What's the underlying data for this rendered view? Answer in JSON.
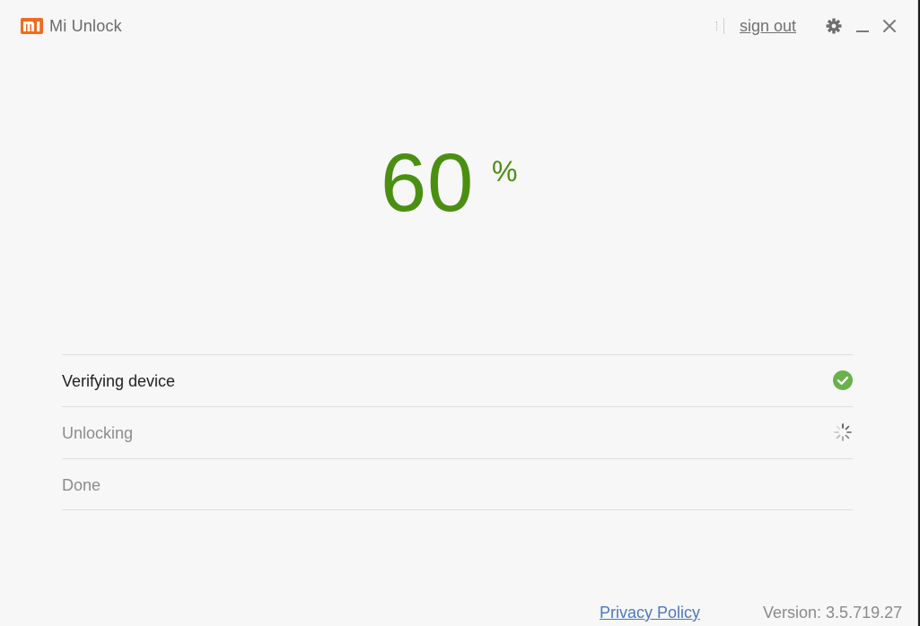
{
  "app": {
    "title": "Mi Unlock",
    "brand_color": "#f26b1f"
  },
  "titlebar": {
    "sign_out_label": "sign out",
    "icons": [
      "gear-icon",
      "minimize-icon",
      "close-icon"
    ]
  },
  "progress": {
    "value": "60",
    "sign": "%",
    "fraction": 0.6,
    "color": "#4a8f12"
  },
  "steps": [
    {
      "label": "Verifying device",
      "status": "done",
      "icon": "check-circle-icon",
      "color": "#6ab04c"
    },
    {
      "label": "Unlocking",
      "status": "in-progress",
      "icon": "spinner-icon"
    },
    {
      "label": "Done",
      "status": "pending"
    }
  ],
  "footer": {
    "privacy_label": "Privacy Policy",
    "version_label": "Version: 3.5.719.27"
  }
}
